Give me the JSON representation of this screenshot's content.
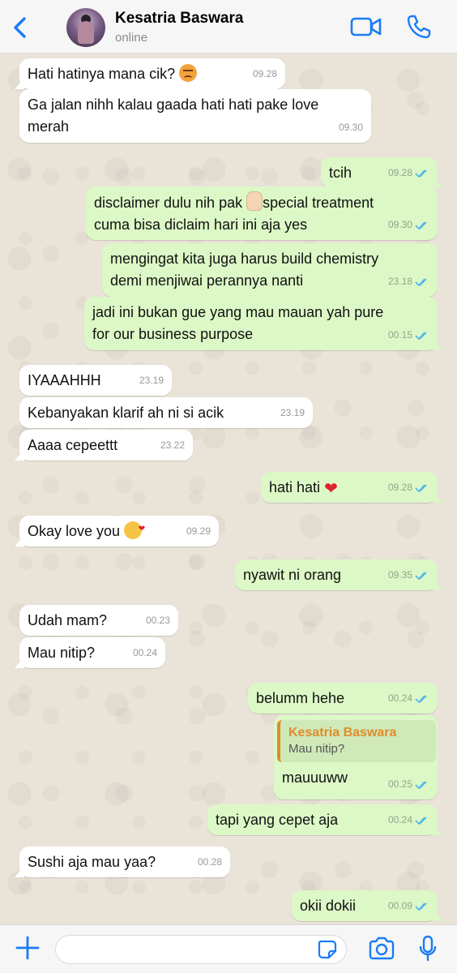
{
  "header": {
    "contact_name": "Kesatria Baswara",
    "status": "online"
  },
  "messages": [
    {
      "dir": "in",
      "text": "Hati hatinya mana cik?",
      "emoji": "angry-face",
      "time": "09.28"
    },
    {
      "dir": "in",
      "text": "Ga jalan nihh kalau gaada hati hati pake love",
      "text2": "merah",
      "time": "09.30"
    },
    {
      "dir": "out",
      "text": "tcih",
      "time": "09.28",
      "status": "read"
    },
    {
      "dir": "out",
      "text": "disclaimer dulu nih pak",
      "emoji": "raised-hand",
      "text_after": "special treatment",
      "text2": "cuma bisa diclaim hari ini aja yes",
      "time": "09.30",
      "status": "read"
    },
    {
      "dir": "out",
      "text": "mengingat kita juga harus build chemistry",
      "text2": "demi menjiwai perannya nanti",
      "time": "23.18",
      "status": "read"
    },
    {
      "dir": "out",
      "text": "jadi ini bukan gue yang mau mauan yah pure",
      "text2": "for our business purpose",
      "time": "00.15",
      "status": "read"
    },
    {
      "dir": "in",
      "text": "IYAAAHHH",
      "time": "23.19"
    },
    {
      "dir": "in",
      "text": "Kebanyakan klarif ah ni si acik",
      "time": "23.19"
    },
    {
      "dir": "in",
      "text": "Aaaa cepeettt",
      "time": "23.22"
    },
    {
      "dir": "out",
      "text": "hati hati",
      "emoji": "red-heart",
      "time": "09.28",
      "status": "read"
    },
    {
      "dir": "in",
      "text": "Okay love you",
      "emoji": "kissing-face",
      "time": "09.29"
    },
    {
      "dir": "out",
      "text": "nyawit ni orang",
      "time": "09.35",
      "status": "read"
    },
    {
      "dir": "in",
      "text": "Udah mam?",
      "time": "00.23"
    },
    {
      "dir": "in",
      "text": "Mau nitip?",
      "time": "00.24"
    },
    {
      "dir": "out",
      "text": "belumm hehe",
      "time": "00.24",
      "status": "read"
    },
    {
      "dir": "out",
      "quote_name": "Kesatria Baswara",
      "quote_text": "Mau nitip?",
      "text": "mauuuww",
      "time": "00.25",
      "status": "read"
    },
    {
      "dir": "out",
      "text": "tapi yang cepet aja",
      "time": "00.24",
      "status": "read"
    },
    {
      "dir": "in",
      "text": "Sushi aja mau yaa?",
      "time": "00.28"
    },
    {
      "dir": "out",
      "text": "okii dokii",
      "time": "00.09",
      "status": "read"
    }
  ],
  "composer": {
    "placeholder": ""
  },
  "colors": {
    "accent": "#1a7cf5",
    "incoming_bubble": "#ffffff",
    "outgoing_bubble": "#dcf8c6",
    "quote_author": "#e08b2c",
    "read_tick": "#4fb5ec"
  },
  "icons": [
    "back-chevron-icon",
    "video-call-icon",
    "phone-icon",
    "plus-icon",
    "sticker-icon",
    "camera-icon",
    "microphone-icon"
  ]
}
